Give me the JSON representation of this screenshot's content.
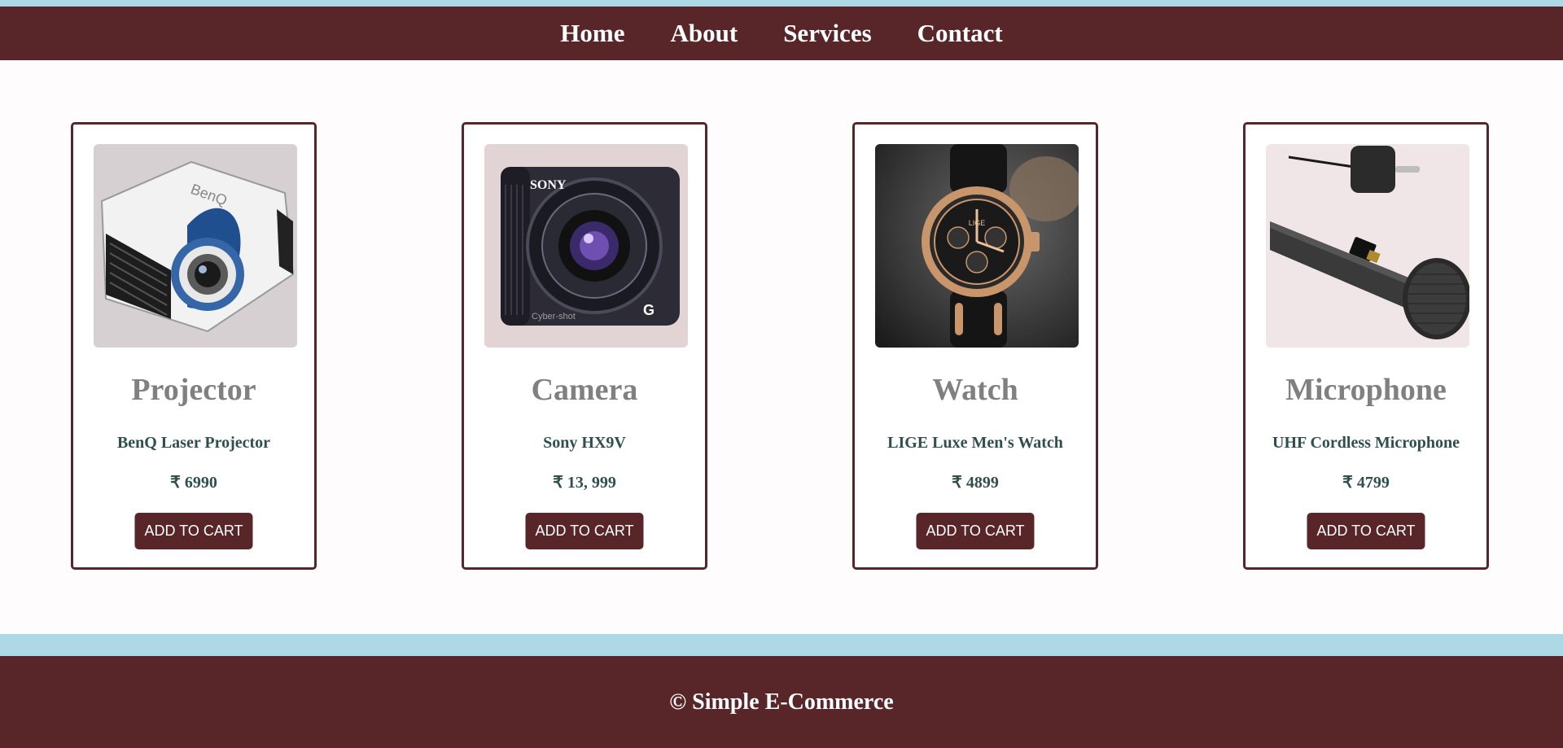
{
  "nav": {
    "items": [
      "Home",
      "About",
      "Services",
      "Contact"
    ]
  },
  "products": [
    {
      "title": "Projector",
      "subtitle": "BenQ Laser Projector",
      "price": "₹ 6990",
      "button": "ADD TO CART",
      "image": "projector-image"
    },
    {
      "title": "Camera",
      "subtitle": "Sony HX9V",
      "price": "₹ 13, 999",
      "button": "ADD TO CART",
      "image": "camera-image"
    },
    {
      "title": "Watch",
      "subtitle": "LIGE Luxe Men's Watch",
      "price": "₹ 4899",
      "button": "ADD TO CART",
      "image": "watch-image"
    },
    {
      "title": "Microphone",
      "subtitle": "UHF Cordless Microphone",
      "price": "₹ 4799",
      "button": "ADD TO CART",
      "image": "microphone-image"
    }
  ],
  "image_text": {
    "camera_brand": "SONY",
    "camera_series": "Cyber-shot",
    "camera_model_mark": "G",
    "projector_brand": "BenQ",
    "watch_brand": "LIGE"
  },
  "footer": {
    "text": "© Simple E-Commerce"
  },
  "colors": {
    "accent": "#582528",
    "top_strip": "#add8e6",
    "title_gray": "#808080",
    "text_dark": "#2f4f4f"
  }
}
